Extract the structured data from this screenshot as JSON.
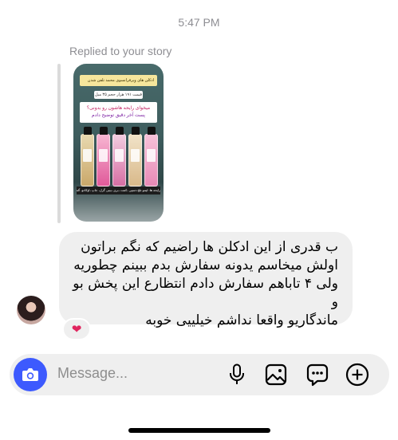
{
  "timestamp": "5:47 PM",
  "reply": {
    "label": "Replied to your story",
    "story_text": {
      "banner": "ادکلن های ویرفرانسوی محمد تلفن شدن",
      "price": "قیمت ۱۹۱ هزار حجم ۳۵ میل",
      "headline_line1": "میخوای رایحه هاشون رو بدونی؟",
      "headline_line2": "پست آخر دقیق توضیح دادم",
      "footer": "رایحه ها: لیمو تلخ،دسپی ،کمت ،بری ،بیبی گرل، جاپ ،اوکادو، آلماتی و ناحیه ی ترکیب"
    }
  },
  "message": {
    "lines": [
      "ب قدری از این ادکلن ها راضیم که نگم براتون",
      "اولش میخاسم یدونه سفارش بدم ببینم چطوریه",
      "ولی ۴ تاباهم سفارش دادم انتظارع این پخش بو و",
      "ماندگاریو واقعا نداشم خیلییی خوبه"
    ],
    "reaction": "❤"
  },
  "composer": {
    "placeholder": "Message..."
  },
  "icons": {
    "camera": "camera-icon",
    "mic": "microphone-icon",
    "gallery": "image-icon",
    "sticker": "sticker-icon",
    "plus": "plus-icon"
  },
  "colors": {
    "accent": "#3d5afe",
    "bubble": "#efefef",
    "muted": "#8e8e93",
    "heart": "#e0245e"
  }
}
